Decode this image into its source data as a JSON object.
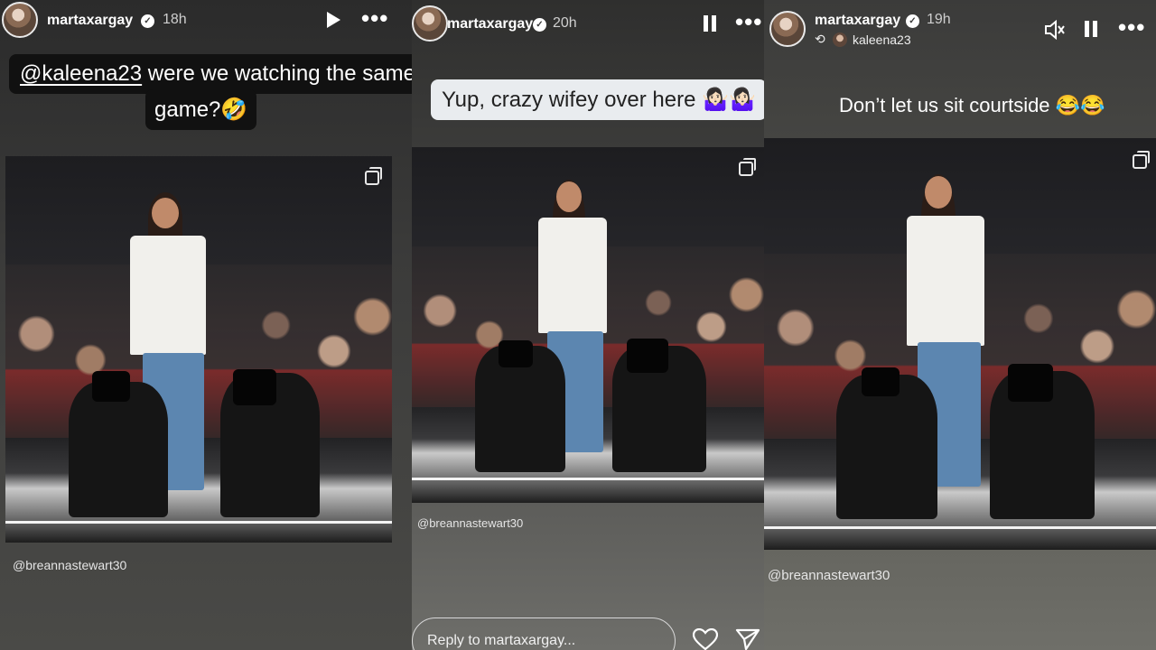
{
  "stories": [
    {
      "username": "martaxargay",
      "time": "18h",
      "sticker_mention": "@kaleena23",
      "sticker_text_1": " were we watching the same",
      "sticker_text_2": "game?🤣",
      "photo_credit": "@breannastewart30",
      "controls": {
        "play_icon": "play-icon",
        "more_icon": "more-icon"
      }
    },
    {
      "username": "martaxargay",
      "time": "20h",
      "sticker_text": "Yup, crazy wifey over here 🤷🏻‍♀️🤷🏻‍♀️",
      "photo_credit": "@breannastewart30",
      "reply_placeholder": "Reply to martaxargay...",
      "controls": {
        "pause_icon": "pause-icon",
        "more_icon": "more-icon",
        "heart_icon": "heart-icon",
        "send_icon": "send-icon"
      }
    },
    {
      "username": "martaxargay",
      "time": "19h",
      "repost_user": "kaleena23",
      "caption": "Don’t let us sit courtside 😂😂",
      "photo_credit": "@breannastewart30",
      "controls": {
        "mute_icon": "muted-speaker-icon",
        "pause_icon": "pause-icon",
        "more_icon": "more-icon"
      }
    }
  ],
  "colors": {
    "sticker_dark": "#111111",
    "sticker_light": "#e9ecef",
    "vest": "#f1f0ec",
    "jeans": "#5c86b0"
  }
}
